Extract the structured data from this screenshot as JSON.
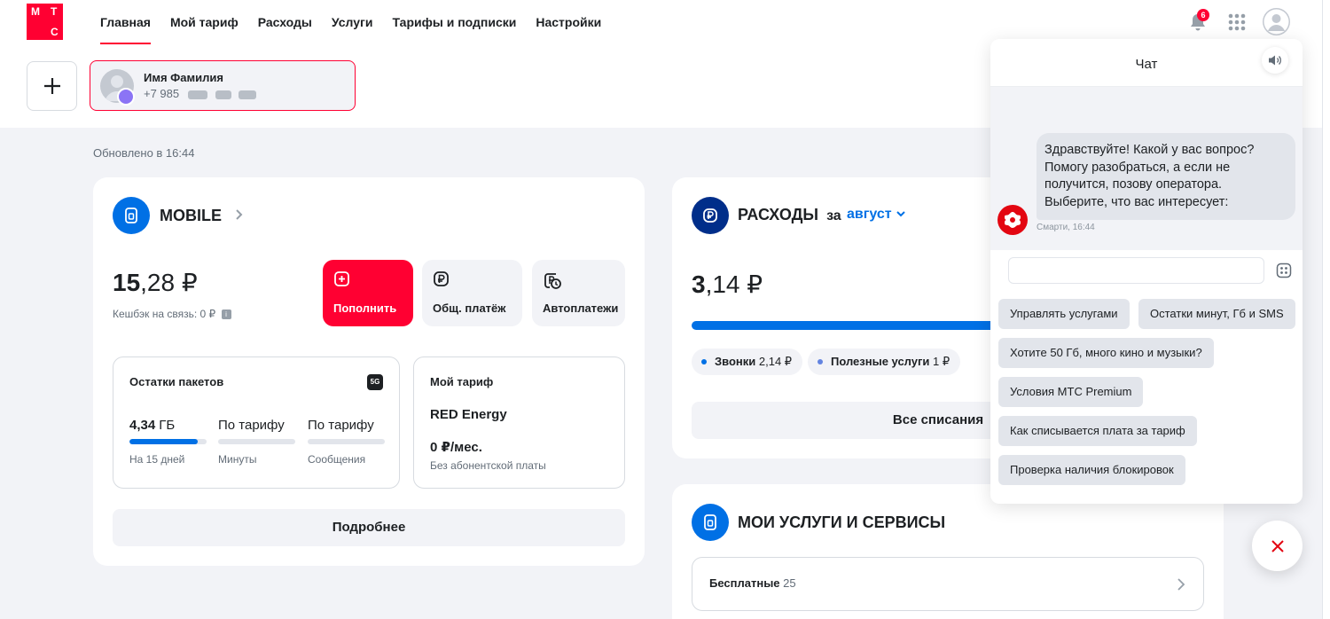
{
  "logo": {
    "l1": "М",
    "l2": "Т",
    "l3": "С"
  },
  "nav": [
    "Главная",
    "Мой тариф",
    "Расходы",
    "Услуги",
    "Тарифы и подписки",
    "Настройки"
  ],
  "header": {
    "notifications_count": "6"
  },
  "account": {
    "name": "Имя Фамилия",
    "phone": "+7 985"
  },
  "updated": "Обновлено в 16:44",
  "mobile": {
    "title": "MOBILE",
    "balance_int": "15",
    "balance_frac": ",28 ₽",
    "cashback": "Кешбэк на связь: 0 ₽",
    "actions": [
      {
        "label": "Пополнить"
      },
      {
        "label": "Общ. платёж"
      },
      {
        "label": "Автоплатежи"
      }
    ],
    "packages": {
      "title": "Остатки пакетов",
      "badge": "5G",
      "items": [
        {
          "value_num": "4,34",
          "value_unit": "ГБ",
          "caption": "На 15 дней",
          "fill": 0.88
        },
        {
          "value_num": "По тарифу",
          "value_unit": "",
          "caption": "Минуты",
          "fill": 0
        },
        {
          "value_num": "По тарифу",
          "value_unit": "",
          "caption": "Сообщения",
          "fill": 0
        }
      ]
    },
    "tariff": {
      "title": "Мой тариф",
      "name": "RED Energy",
      "price": "0 ₽/мес.",
      "note": "Без абонентской платы"
    },
    "more_button": "Подробнее"
  },
  "expenses": {
    "title": "РАСХОДЫ",
    "for": "за",
    "month": "август",
    "amount_int": "3",
    "amount_frac": ",14 ₽",
    "pills": [
      {
        "label": "Звонки",
        "value": "2,14 ₽",
        "color": "#0070e5"
      },
      {
        "label": "Полезные услуги",
        "value": "1 ₽",
        "color": "#6384e0"
      }
    ],
    "all_button": "Все списания",
    "colors": {
      "bar": "#0070e5"
    }
  },
  "services": {
    "title": "МОИ УСЛУГИ И СЕРВИСЫ",
    "free_label": "Бесплатные",
    "free_count": "25"
  },
  "chat": {
    "title": "Чат",
    "message": "Здравствуйте! Какой у вас вопрос? Помогу разобраться, а если не получится, позову оператора. Выберите, что вас интересует:",
    "meta": "Смарти, 16:44",
    "input_placeholder": "",
    "chips": [
      "Управлять услугами",
      "Остатки минут, Гб и SMS",
      "Хотите 50 Гб, много кино и музыки?",
      "Условия МТС Premium",
      "Как списывается плата за тариф",
      "Проверка наличия блокировок"
    ]
  },
  "colors": {
    "brand": "#ff0032",
    "accent_blue": "#0070e5",
    "dark_blue": "#003c96",
    "text": "#1d2023",
    "muted": "#626c77"
  }
}
